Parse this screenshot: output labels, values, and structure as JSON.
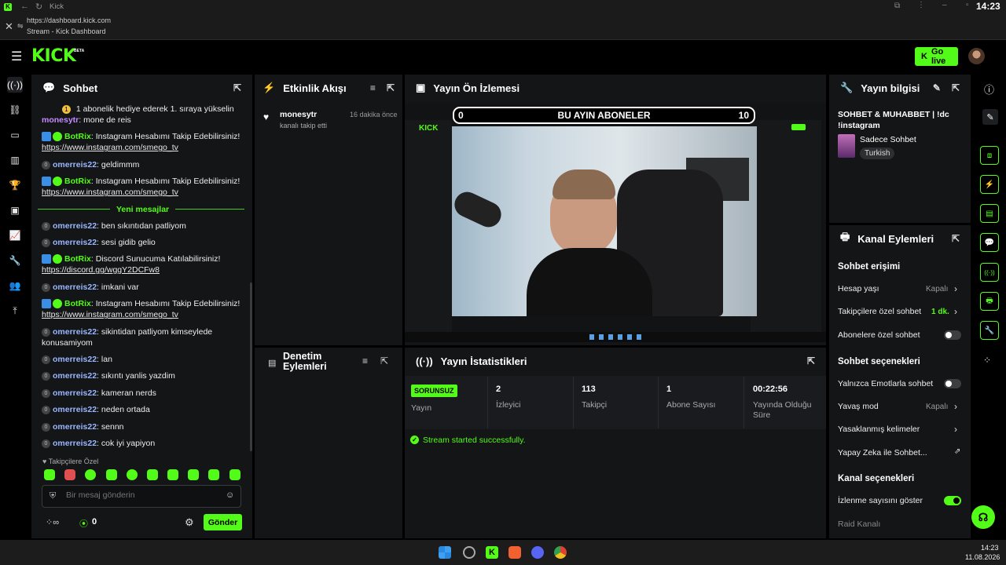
{
  "browser": {
    "tab_title": "Kick",
    "url": "https://dashboard.kick.com",
    "page_title": "Stream - Kick Dashboard",
    "clock": "14:23"
  },
  "header": {
    "logo": "KICK",
    "logo_badge": "BETA",
    "go_live_label": "Go live"
  },
  "chat": {
    "title": "Sohbet",
    "pinned": "1 abonelik hediye ederek 1. sıraya yükselin",
    "partial_line": {
      "user": "monesytr",
      "text": "mone de reis"
    },
    "messages_before": [
      {
        "user": "BotRix",
        "type": "bot",
        "text": "Instagram Hesabımı Takip Edebilirsiniz!",
        "link": "https://www.instagram.com/smego_tv"
      },
      {
        "user": "omerreis22",
        "type": "user",
        "text": "geldimmm"
      },
      {
        "user": "BotRix",
        "type": "bot",
        "text": "Instagram Hesabımı Takip Edebilirsiniz!",
        "link": "https://www.instagram.com/smego_tv"
      }
    ],
    "new_messages_label": "Yeni mesajlar",
    "messages_after": [
      {
        "user": "omerreis22",
        "text": "ben sıkıntıdan patliyom"
      },
      {
        "user": "omerreis22",
        "text": "sesi gidib gelio"
      },
      {
        "user": "BotRix",
        "text": "Discord Sunucuma Katılabilirsiniz!",
        "link": "https://discord.gg/wggY2DCFw8"
      },
      {
        "user": "omerreis22",
        "text": "imkani var"
      },
      {
        "user": "BotRix",
        "text": "Instagram Hesabımı Takip Edebilirsiniz!",
        "link": "https://www.instagram.com/smego_tv"
      },
      {
        "user": "omerreis22",
        "text": "sikintidan patliyom kimseylede konusamiyom"
      },
      {
        "user": "omerreis22",
        "text": "lan"
      },
      {
        "user": "omerreis22",
        "text": "sıkıntı yanlis yazdim"
      },
      {
        "user": "omerreis22",
        "text": "kameran nerds"
      },
      {
        "user": "omerreis22",
        "text": "neden ortada"
      },
      {
        "user": "omerreis22",
        "text": "sennn"
      },
      {
        "user": "omerreis22",
        "text": "cok iyi yapiyon"
      }
    ],
    "emote_section_label": "Takipçilere Özel",
    "input_placeholder": "Bir mesaj gönderin",
    "points_value": "0",
    "send_label": "Gönder"
  },
  "activity": {
    "title": "Etkinlik Akışı",
    "items": [
      {
        "user": "monesytr",
        "action": "kanalı takip etti",
        "time": "16 dakika önce"
      }
    ]
  },
  "moderation": {
    "title": "Denetim Eylemleri"
  },
  "preview": {
    "title": "Yayın Ön İzlemesi",
    "overlay_left": "0",
    "overlay_title": "BU AYIN ABONELER",
    "overlay_right": "10"
  },
  "stats": {
    "title": "Yayın İstatistikleri",
    "status_badge": "SORUNSUZ",
    "columns": [
      {
        "value": "",
        "label": "Yayın"
      },
      {
        "value": "2",
        "label": "İzleyici"
      },
      {
        "value": "113",
        "label": "Takipçi"
      },
      {
        "value": "1",
        "label": "Abone Sayısı"
      },
      {
        "value": "00:22:56",
        "label": "Yayında Olduğu Süre"
      }
    ],
    "message": "Stream started successfully."
  },
  "stream_info": {
    "title": "Yayın bilgisi",
    "stream_title": "SOHBET & MUHABBET | !dc !instagram",
    "category": "Sadece Sohbet",
    "language": "Turkish"
  },
  "channel_actions": {
    "title": "Kanal Eylemleri",
    "chat_access_title": "Sohbet erişimi",
    "account_age_label": "Hesap yaşı",
    "account_age_value": "Kapalı",
    "followers_only_label": "Takipçilere özel sohbet",
    "followers_only_value": "1 dk.",
    "subs_only_label": "Abonelere özel sohbet",
    "chat_options_title": "Sohbet seçenekleri",
    "emote_only_label": "Yalnızca Emotlarla sohbet",
    "slow_mode_label": "Yavaş mod",
    "slow_mode_value": "Kapalı",
    "banned_words_label": "Yasaklanmış kelimeler",
    "ai_chat_label": "Yapay Zeka ile Sohbet...",
    "channel_options_title": "Kanal seçenekleri",
    "show_viewers_label": "İzlenme sayısını göster",
    "raid_label": "Raid Kanalı"
  },
  "taskbar": {
    "time": "14:23",
    "date": "11.08.2026"
  },
  "colors": {
    "accent": "#53fc18",
    "panel": "#141517",
    "background": "#000000"
  }
}
